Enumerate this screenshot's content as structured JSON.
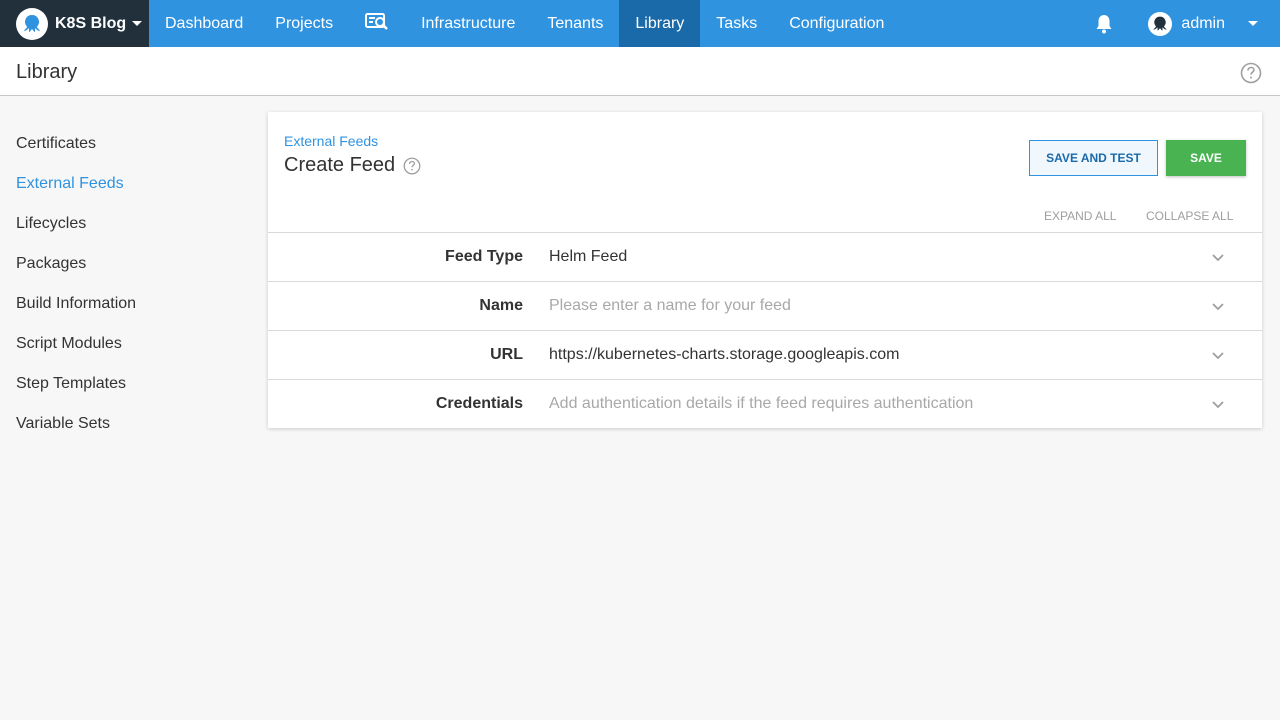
{
  "nav": {
    "brand": "K8S Blog",
    "items": [
      {
        "label": "Dashboard",
        "icon": null
      },
      {
        "label": "Projects",
        "icon": null
      },
      {
        "label": "",
        "icon": "search-card-icon"
      },
      {
        "label": "Infrastructure",
        "icon": null
      },
      {
        "label": "Tenants",
        "icon": null
      },
      {
        "label": "Library",
        "icon": null,
        "active": true
      },
      {
        "label": "Tasks",
        "icon": null
      },
      {
        "label": "Configuration",
        "icon": null
      }
    ],
    "user": "admin"
  },
  "page": {
    "title": "Library"
  },
  "sidebar": {
    "items": [
      {
        "label": "Certificates"
      },
      {
        "label": "External Feeds",
        "active": true
      },
      {
        "label": "Lifecycles"
      },
      {
        "label": "Packages"
      },
      {
        "label": "Build Information"
      },
      {
        "label": "Script Modules"
      },
      {
        "label": "Step Templates"
      },
      {
        "label": "Variable Sets"
      }
    ]
  },
  "card": {
    "breadcrumb": "External Feeds",
    "title": "Create Feed",
    "save_and_test_label": "SAVE AND TEST",
    "save_label": "SAVE",
    "expand_all": "EXPAND ALL",
    "collapse_all": "COLLAPSE ALL",
    "rows": [
      {
        "label": "Feed Type",
        "value": "Helm Feed",
        "placeholder": false
      },
      {
        "label": "Name",
        "value": "Please enter a name for your feed",
        "placeholder": true
      },
      {
        "label": "URL",
        "value": "https://kubernetes-charts.storage.googleapis.com",
        "placeholder": false
      },
      {
        "label": "Credentials",
        "value": "Add authentication details if the feed requires authentication",
        "placeholder": true
      }
    ]
  },
  "colors": {
    "nav_bg": "#2f93e0",
    "nav_active": "#1a69a8",
    "brand_bg": "#22303c",
    "save_green": "#48b350",
    "link_blue": "#2f93e0"
  }
}
